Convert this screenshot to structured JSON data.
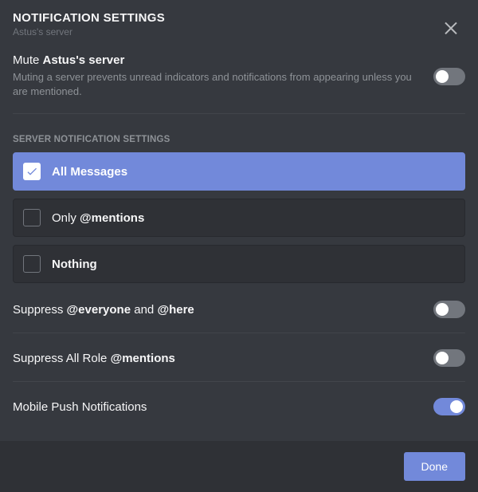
{
  "header": {
    "title": "NOTIFICATION SETTINGS",
    "subtitle": "Astus's server"
  },
  "mute": {
    "prefix": "Mute ",
    "server": "Astus's server",
    "desc": "Muting a server prevents unread indicators and notifications from appearing unless you are mentioned.",
    "enabled": false
  },
  "section_label": "SERVER NOTIFICATION SETTINGS",
  "options": {
    "all": {
      "text": "All Messages",
      "selected": true
    },
    "mentions": {
      "pre": "Only ",
      "bold": "@mentions",
      "selected": false
    },
    "nothing": {
      "text": "Nothing",
      "selected": false
    }
  },
  "toggles": {
    "suppress_everyone": {
      "p1": "Suppress ",
      "b1": "@everyone",
      "p2": " and ",
      "b2": "@here",
      "enabled": false
    },
    "suppress_roles": {
      "p1": "Suppress All Role ",
      "b1": "@mentions",
      "enabled": false
    },
    "mobile": {
      "label": "Mobile Push Notifications",
      "enabled": true
    }
  },
  "footer": {
    "done": "Done"
  }
}
